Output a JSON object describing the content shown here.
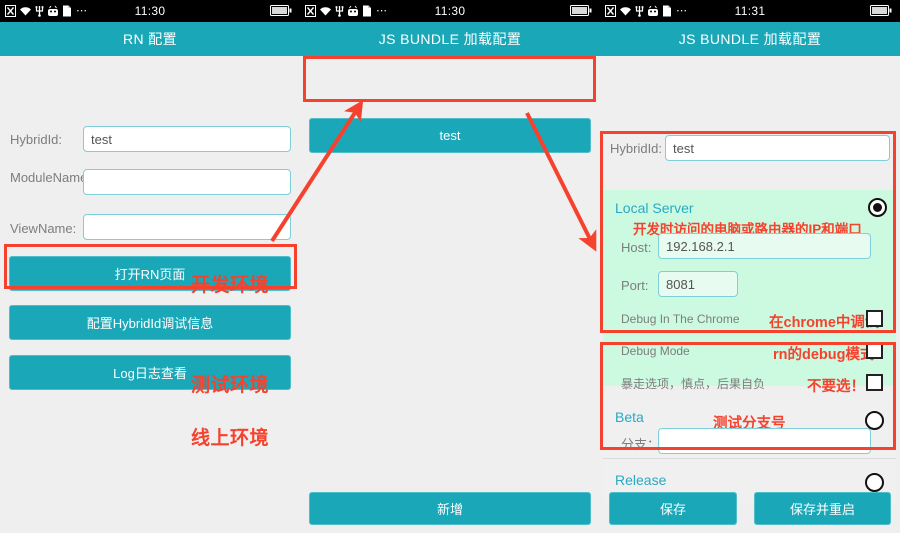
{
  "statusbar": {
    "time_left": "11:30",
    "time_mid": "11:30",
    "time_right": "11:31",
    "dots": "⋯",
    "icons": [
      "sim-x-icon",
      "wifi-icon",
      "usb-icon",
      "android-robot-icon",
      "sdcard-icon",
      "more-icon",
      "battery-icon"
    ]
  },
  "colors": {
    "teal": "#1aa8b8",
    "panel_bg": "#efefef",
    "green_bg": "#ccfae0",
    "annotation_red": "#f5422e",
    "link_blue": "#2aa9c4",
    "field_border": "#7fcfd8"
  },
  "left_panel": {
    "title": "RN 配置",
    "fields": [
      {
        "label": "HybridId:",
        "value": "test",
        "placeholder": ""
      },
      {
        "label": "ModuleName：",
        "value": "",
        "placeholder": ""
      },
      {
        "label": "ViewName:",
        "value": "",
        "placeholder": ""
      }
    ],
    "buttons": [
      {
        "label": "打开RN页面"
      },
      {
        "label": "配置HybridId调试信息"
      },
      {
        "label": "Log日志查看"
      }
    ]
  },
  "mid_panel": {
    "title": "JS BUNDLE 加载配置",
    "bundle_button": "test",
    "add_button": "新增",
    "annotations": [
      "开发环境",
      "测试环境",
      "线上环境"
    ]
  },
  "right_panel": {
    "title": "JS BUNDLE 加载配置",
    "hybrid": {
      "label": "HybridId:",
      "value": "test"
    },
    "local_server": {
      "title": "Local Server",
      "annotation": "开发时访问的电脑或路由器的IP和端口",
      "selected": true,
      "host": {
        "label": "Host:",
        "value": "192.168.2.1"
      },
      "port": {
        "label": "Port:",
        "value": "8081"
      },
      "checkboxes": [
        {
          "label": "Debug In The Chrome",
          "note": "在chrome中调试",
          "checked": false
        },
        {
          "label": "Debug Mode",
          "note": "rn的debug模式",
          "checked": false
        },
        {
          "label": "暴走选项，慎点，后果自负",
          "note": "不要选！",
          "checked": false
        }
      ]
    },
    "beta": {
      "title": "Beta",
      "annotation": "测试分支号",
      "selected": false,
      "branch": {
        "label": "分支：",
        "value": "",
        "placeholder": ""
      }
    },
    "release": {
      "title": "Release",
      "selected": false
    },
    "buttons": [
      {
        "label": "保存"
      },
      {
        "label": "保存并重启"
      }
    ]
  }
}
